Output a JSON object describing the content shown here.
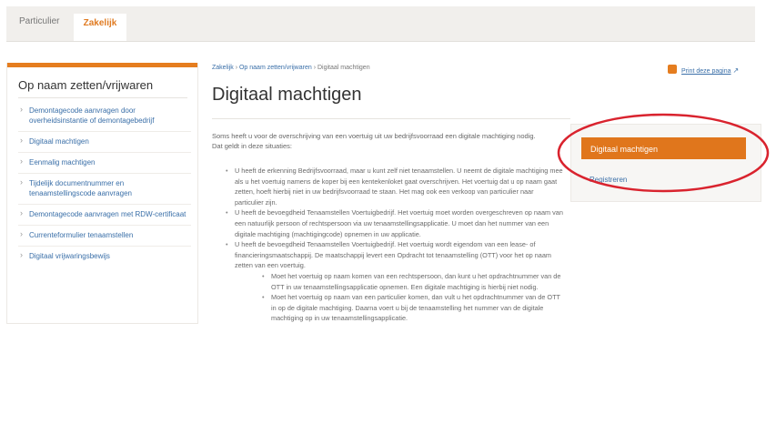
{
  "tabs": [
    {
      "label": "Particulier",
      "active": false
    },
    {
      "label": "Zakelijk",
      "active": true
    }
  ],
  "sidebar": {
    "title": "Op naam zetten/vrijwaren",
    "items": [
      {
        "label": "Demontagecode aanvragen door overheidsinstantie of demontagebedrijf"
      },
      {
        "label": "Digitaal machtigen"
      },
      {
        "label": "Eenmalig machtigen"
      },
      {
        "label": "Tijdelijk documentnummer en tenaamstellingscode aanvragen"
      },
      {
        "label": "Demontagecode aanvragen met RDW-certificaat"
      },
      {
        "label": "Currenteformulier tenaamstellen"
      },
      {
        "label": "Digitaal vrijwaringsbewijs"
      }
    ]
  },
  "breadcrumb": {
    "items": [
      "Zakelijk",
      "Op naam zetten/vrijwaren",
      "Digitaal machtigen"
    ],
    "separator": "›"
  },
  "main": {
    "title": "Digitaal machtigen",
    "print_label": "Print deze pagina",
    "intro": "Soms heeft u voor de overschrijving van een voertuig uit uw bedrijfsvoorraad een digitale machtiging nodig. Dat geldt in deze situaties:",
    "bullets": [
      "U heeft de erkenning Bedrijfsvoorraad, maar u kunt zelf niet tenaamstellen. U neemt de digitale machtiging mee als u het voertuig namens de koper bij een kentekenloket gaat overschrijven. Het voertuig dat u op naam gaat zetten, hoeft hierbij niet in uw bedrijfsvoorraad te staan. Het mag ook een verkoop van particulier naar particulier zijn.",
      "U heeft de bevoegdheid Tenaamstellen Voertuigbedrijf. Het voertuig moet worden overgeschreven op naam van een natuurlijk persoon of rechtspersoon via uw tenaamstellingsapplicatie. U moet dan het nummer van een digitale machtiging (machtigingcode) opnemen in uw applicatie.",
      "U heeft de bevoegdheid Tenaamstellen Voertuigbedrijf. Het voertuig wordt eigendom van een lease- of financieringsmaatschappij. De maatschappij levert een Opdracht tot tenaamstelling (OTT) voor het op naam zetten van een voertuig."
    ],
    "subbullets": [
      "Moet het voertuig op naam komen van een rechtspersoon, dan kunt u het opdrachtnummer van de OTT in uw tenaamstellingsapplicatie opnemen. Een digitale machtiging is hierbij niet nodig.",
      "Moet het voertuig op naam van een particulier komen, dan vult u het opdrachtnummer van de OTT in op de digitale machtiging. Daarna voert u bij de tenaamstelling het nummer van de digitale machtiging op in uw tenaamstellingsapplicatie."
    ]
  },
  "rightbox": {
    "button_label": "Digitaal machtigen",
    "link_label": "Registreren"
  },
  "colors": {
    "accent": "#e0761c",
    "link": "#3a6fa8",
    "highlight": "#d9232e"
  },
  "icons": {
    "print": "printer-icon",
    "external": "external-link-icon"
  }
}
